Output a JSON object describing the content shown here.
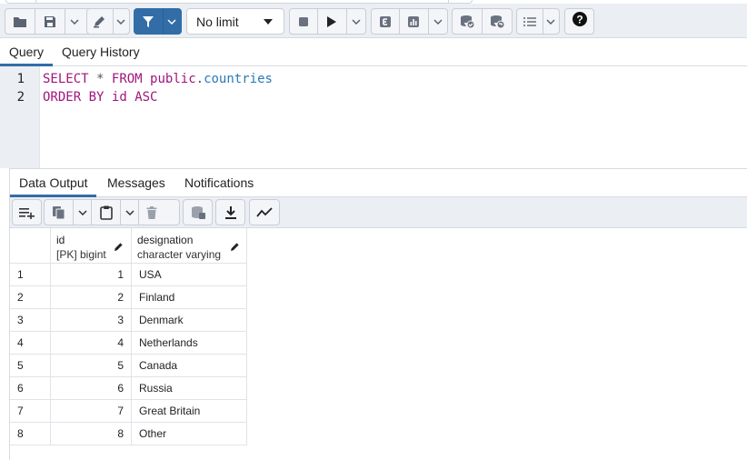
{
  "toolbar": {
    "limit_value": "No limit",
    "icons": [
      "folder-open-icon",
      "save-icon",
      "chevron-down-icon",
      "edit-pen-icon",
      "chevron-down-icon",
      "filter-icon",
      "chevron-down-icon",
      "stop-icon",
      "play-icon",
      "chevron-down-icon",
      "explain-icon",
      "explain-analyze-icon",
      "chevron-down-icon",
      "commit-icon",
      "rollback-icon",
      "macros-icon",
      "chevron-down-icon",
      "help-icon"
    ]
  },
  "query_tabs": [
    {
      "label": "Query",
      "active": true
    },
    {
      "label": "Query History",
      "active": false
    }
  ],
  "editor": {
    "line_numbers": [
      "1",
      "2"
    ],
    "line1": {
      "kw1": "SELECT",
      "star": "*",
      "kw2": "FROM",
      "schema": "public",
      "dot": ".",
      "table": "countries"
    },
    "line2": {
      "kw1": "ORDER",
      "kw2": "BY",
      "col": "id",
      "kw3": "ASC"
    }
  },
  "result_tabs": [
    {
      "label": "Data Output",
      "active": true
    },
    {
      "label": "Messages",
      "active": false
    },
    {
      "label": "Notifications",
      "active": false
    }
  ],
  "grid": {
    "columns": [
      {
        "name": "id",
        "type": "[PK] bigint"
      },
      {
        "name": "designation",
        "type": "character varying"
      }
    ],
    "rows": [
      {
        "rownum": "1",
        "id": "1",
        "designation": "USA"
      },
      {
        "rownum": "2",
        "id": "2",
        "designation": "Finland"
      },
      {
        "rownum": "3",
        "id": "3",
        "designation": "Denmark"
      },
      {
        "rownum": "4",
        "id": "4",
        "designation": "Netherlands"
      },
      {
        "rownum": "5",
        "id": "5",
        "designation": "Canada"
      },
      {
        "rownum": "6",
        "id": "6",
        "designation": "Russia"
      },
      {
        "rownum": "7",
        "id": "7",
        "designation": "Great Britain"
      },
      {
        "rownum": "8",
        "id": "8",
        "designation": "Other"
      }
    ]
  },
  "colors": {
    "accent": "#326da8",
    "keyword": "#a0157d",
    "table_name": "#2a7ab8",
    "toolbar_bg": "#ebeef3"
  }
}
